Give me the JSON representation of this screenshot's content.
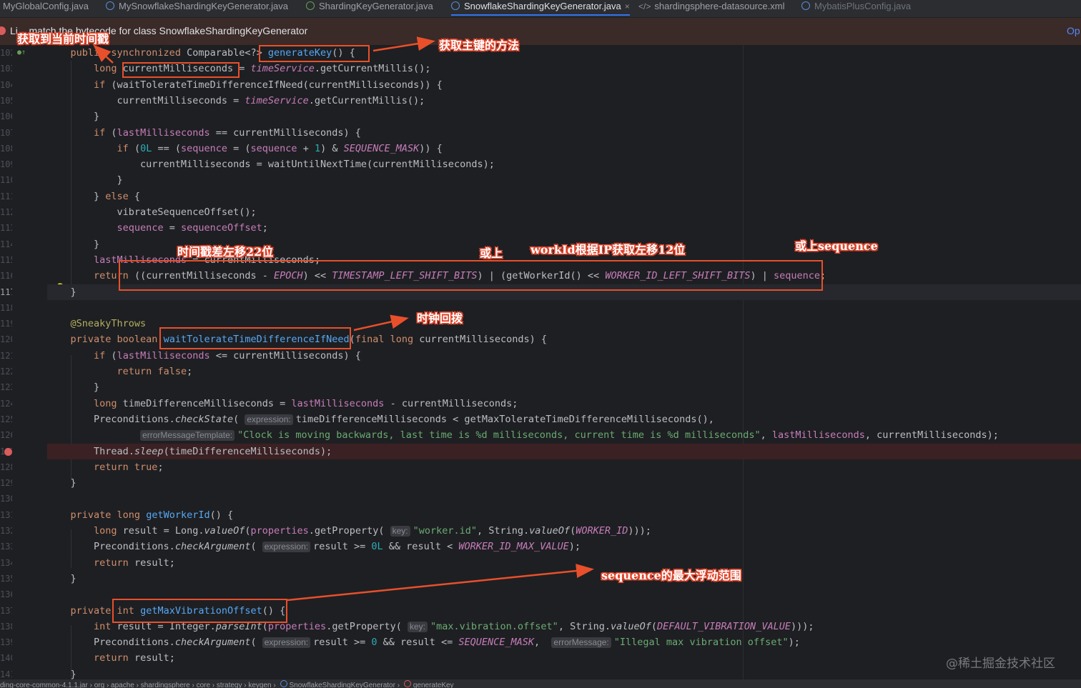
{
  "tabs": [
    {
      "label": "MyGlobalConfig.java",
      "icon": "java-file-icon"
    },
    {
      "label": "MySnowflakeShardingKeyGenerator.java",
      "icon": "class-icon"
    },
    {
      "label": "ShardingKeyGenerator.java",
      "icon": "interface-icon"
    },
    {
      "label": "SnowflakeShardingKeyGenerator.java",
      "icon": "class-icon",
      "active": true
    },
    {
      "label": "shardingsphere-datasource.xml",
      "icon": "xml-icon"
    },
    {
      "label": "MybatisPlusConfig.java",
      "icon": "class-icon"
    }
  ],
  "banner": {
    "message": "Li... match the bytecode for class SnowflakeShardingKeyGenerator",
    "action": "Op"
  },
  "line_numbers": [
    "102",
    "103",
    "104",
    "105",
    "106",
    "107",
    "108",
    "109",
    "110",
    "111",
    "112",
    "113",
    "114",
    "115",
    "116",
    "117",
    "118",
    "119",
    "120",
    "121",
    "122",
    "123",
    "124",
    "125",
    "126",
    "127",
    "128",
    "129",
    "130",
    "131",
    "132",
    "133",
    "134",
    "135",
    "136",
    "137",
    "138",
    "139",
    "140",
    "141"
  ],
  "hints": {
    "expression": "expression:",
    "error_template": "errorMessageTemplate:",
    "key": "key:",
    "error_message": "errorMessage:"
  },
  "annotations": {
    "get_current_time": "获取到当前时间戳",
    "get_key_method": "获取主键的方法",
    "timestamp_shift": "时间戳差左移22位",
    "or_1": "或上",
    "worker_id_shift": "workId根据IP获取左移12位",
    "or_sequence": "或上sequence",
    "clock_backwards": "时钟回拨",
    "sequence_range": "sequence的最大浮动范围"
  },
  "status_bar": {
    "breadcrumb": "ding-core-common-4.1.1.jar  ›  org  ›  apache  ›  shardingsphere  ›  core  ›  strategy  ›  keygen  ›",
    "class_crumb": "SnowflakeShardingKeyGenerator",
    "method_crumb": "generateKey"
  },
  "watermark": "@稀土掘金技术社区",
  "colors": {
    "background": "#1e1f22",
    "keyword": "#cf8e6d",
    "function": "#56a8f5",
    "field": "#c77dbb",
    "string": "#6aab73",
    "number": "#2aacb8",
    "annotation_red": "#e8502b"
  }
}
